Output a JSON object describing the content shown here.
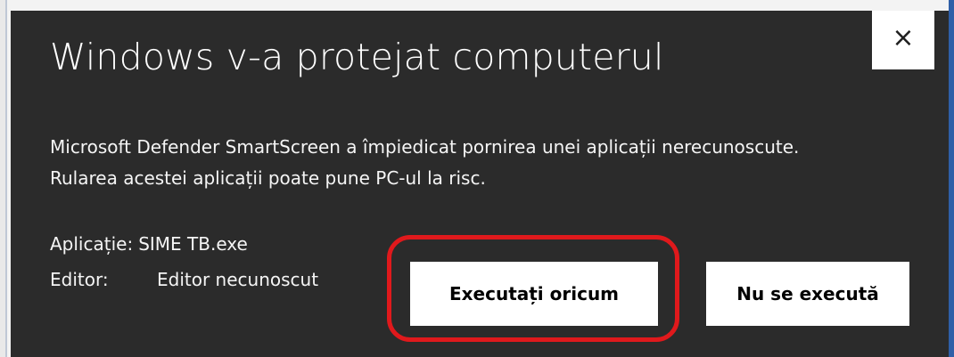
{
  "dialog": {
    "title": "Windows v-a protejat computerul",
    "close_glyph": "×",
    "message": "Microsoft Defender SmartScreen a împiedicat pornirea unei aplicații nerecunoscute. Rularea acestei aplicații poate pune PC-ul la risc.",
    "app_label": "Aplicație:",
    "app_value": "SIME TB.exe",
    "publisher_label": "Editor:",
    "publisher_value": "Editor necunoscut",
    "run_anyway_label": "Executați oricum",
    "dont_run_label": "Nu se execută"
  },
  "colors": {
    "dialog_background": "#2b2b2b",
    "highlight": "#e0191c"
  }
}
